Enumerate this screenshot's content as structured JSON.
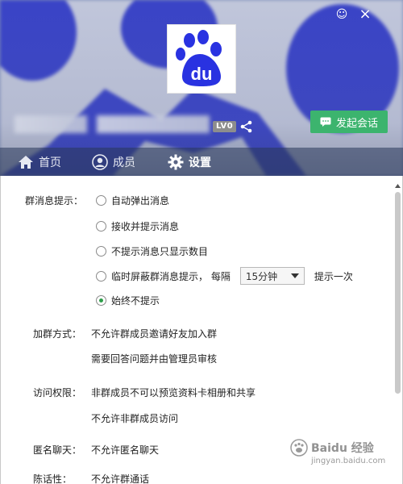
{
  "window": {
    "skin_glyph": "☺",
    "close_glyph": "×"
  },
  "group": {
    "avatar_text": "du",
    "level_badge": "LV0"
  },
  "header": {
    "chat_button_label": "发起会话"
  },
  "tabs": [
    {
      "label": "首页",
      "icon": "home-icon",
      "active": false
    },
    {
      "label": "成员",
      "icon": "person-icon",
      "active": false
    },
    {
      "label": "设置",
      "icon": "gear-icon",
      "active": true
    }
  ],
  "settings": {
    "notify": {
      "label": "群消息提示：",
      "options": [
        {
          "label": "自动弹出消息",
          "checked": false
        },
        {
          "label": "接收并提示消息",
          "checked": false
        },
        {
          "label": "不提示消息只显示数目",
          "checked": false
        },
        {
          "label": "临时屏蔽群消息提示，  每隔",
          "checked": false,
          "select_value": "15分钟",
          "suffix": "提示一次"
        },
        {
          "label": "始终不提示",
          "checked": true
        }
      ]
    },
    "join": {
      "label": "加群方式：",
      "items": [
        "不允许群成员邀请好友加入群",
        "需要回答问题并由管理员审核"
      ]
    },
    "access": {
      "label": "访问权限：",
      "items": [
        "非群成员不可以预览资料卡相册和共享",
        "不允许非群成员访问"
      ]
    },
    "anonymous": {
      "label": "匿名聊天：",
      "items": [
        "不允许匿名聊天"
      ]
    },
    "call": {
      "label": "陈话性：",
      "items": [
        "不允许群通话"
      ]
    }
  },
  "watermark": {
    "text1": "Baidu 经验",
    "text2": "jingyan.baidu.com"
  },
  "colors": {
    "accent_green": "#3cb46e",
    "radio_check": "#2e9e4a",
    "baidu_blue": "#2932e1"
  }
}
